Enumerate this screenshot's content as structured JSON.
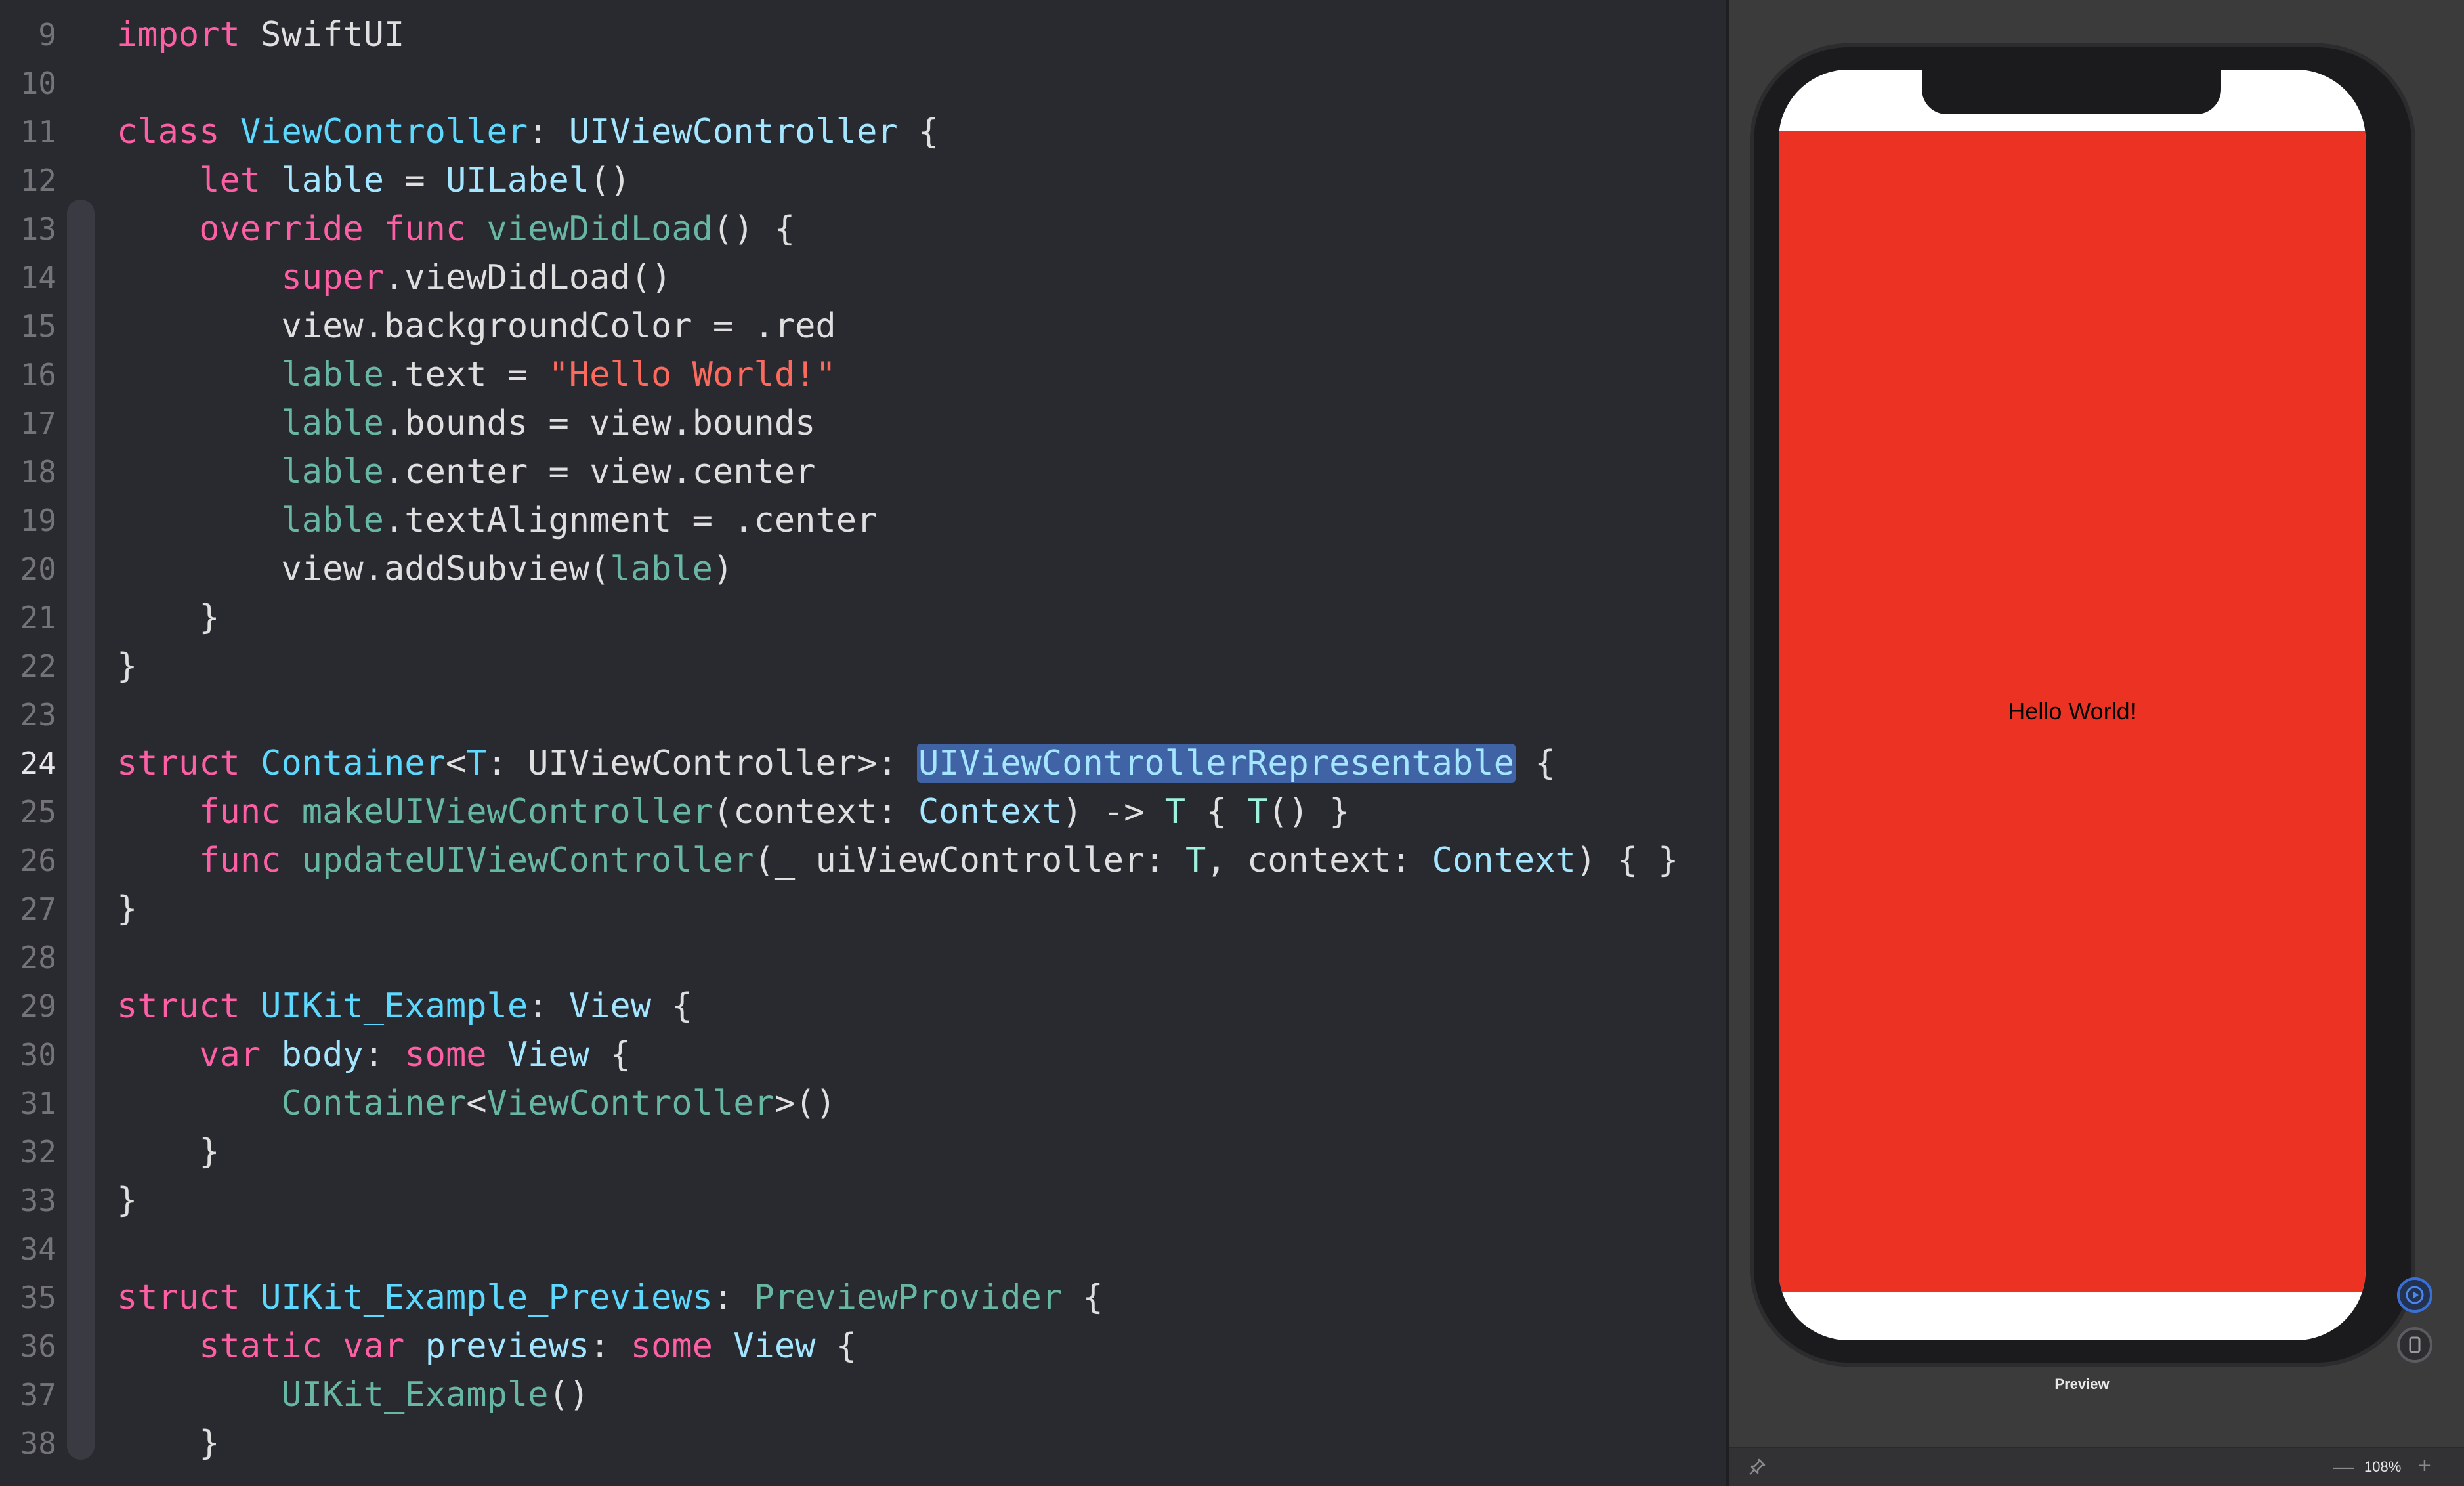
{
  "editor": {
    "current_line": "24",
    "line_numbers": [
      "9",
      "10",
      "11",
      "12",
      "13",
      "14",
      "15",
      "16",
      "17",
      "18",
      "19",
      "20",
      "21",
      "22",
      "23",
      "24",
      "25",
      "26",
      "27",
      "28",
      "29",
      "30",
      "31",
      "32",
      "33",
      "34",
      "35",
      "36",
      "37",
      "38"
    ],
    "tokens": {
      "l9": [
        "import",
        " SwiftUI"
      ],
      "l11": [
        "class",
        " ",
        "ViewController",
        ": ",
        "UIViewController",
        " {"
      ],
      "l12": [
        "    ",
        "let",
        " ",
        "lable",
        " = ",
        "UILabel",
        "()"
      ],
      "l13": [
        "    ",
        "override",
        " ",
        "func",
        " ",
        "viewDidLoad",
        "() {"
      ],
      "l14": [
        "        ",
        "super",
        ".viewDidLoad()"
      ],
      "l15": [
        "        ",
        "view.backgroundColor = .red"
      ],
      "l16": [
        "        ",
        "lable",
        ".text = ",
        "\"Hello World!\""
      ],
      "l17": [
        "        ",
        "lable",
        ".bounds = view.bounds"
      ],
      "l18": [
        "        ",
        "lable",
        ".center = view.center"
      ],
      "l19": [
        "        ",
        "lable",
        ".textAlignment = .center"
      ],
      "l20": [
        "        ",
        "view.addSubview(",
        "lable",
        ")"
      ],
      "l21": [
        "    }"
      ],
      "l22": [
        "}"
      ],
      "l24": [
        "struct",
        " ",
        "Container",
        "<",
        "T",
        ": UIViewController>: ",
        "UIViewControllerRepresentable",
        " {"
      ],
      "l25": [
        "    ",
        "func",
        " ",
        "makeUIViewController",
        "(context: ",
        "Context",
        ") -> ",
        "T",
        " { ",
        "T",
        "() }"
      ],
      "l26": [
        "    ",
        "func",
        " ",
        "updateUIViewController",
        "(_ uiViewController: ",
        "T",
        ", context: ",
        "Context",
        ") { }"
      ],
      "l27": [
        "}"
      ],
      "l29": [
        "struct",
        " ",
        "UIKit_Example",
        ": ",
        "View",
        " {"
      ],
      "l30": [
        "    ",
        "var",
        " ",
        "body",
        ": ",
        "some",
        " ",
        "View",
        " {"
      ],
      "l31": [
        "        ",
        "Container",
        "<",
        "ViewController",
        ">()"
      ],
      "l32": [
        "    }"
      ],
      "l33": [
        "}"
      ],
      "l35": [
        "struct",
        " ",
        "UIKit_Example_Previews",
        ": ",
        "PreviewProvider",
        " {"
      ],
      "l36": [
        "    ",
        "static",
        " ",
        "var",
        " ",
        "previews",
        ": ",
        "some",
        " ",
        "View",
        " {"
      ],
      "l37": [
        "        ",
        "UIKit_Example",
        "()"
      ],
      "l38": [
        "    }"
      ]
    }
  },
  "preview": {
    "label": "Preview",
    "device_text": "Hello World!",
    "view_background": "#ec3323",
    "zoom_level": "108%",
    "zoom_out_symbol": "—",
    "zoom_in_symbol": "+"
  },
  "icons": [
    "pin-icon",
    "live-preview-icon",
    "device-preview-icon"
  ]
}
